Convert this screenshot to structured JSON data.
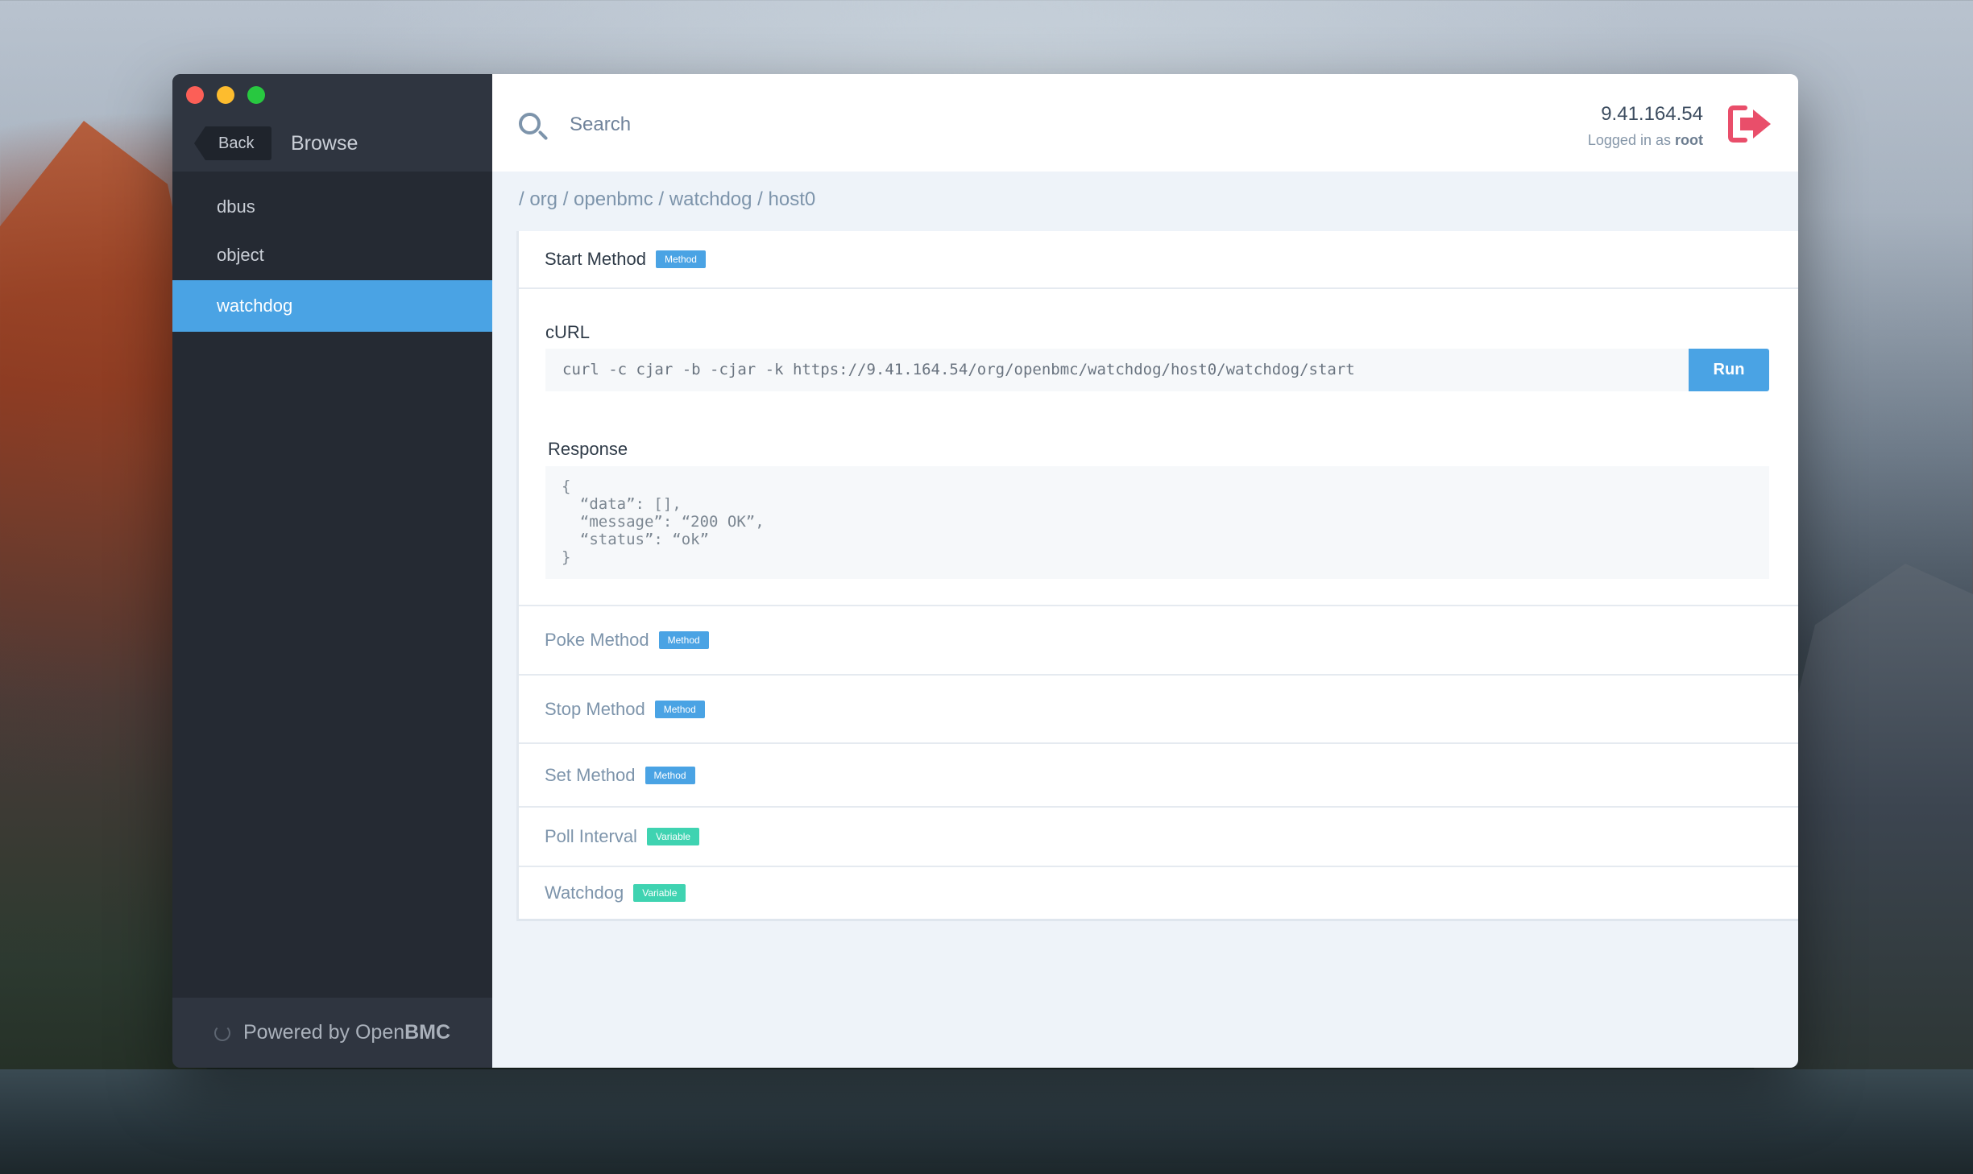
{
  "window": {
    "sidebar": {
      "back_label": "Back",
      "title": "Browse",
      "items": [
        {
          "label": "dbus"
        },
        {
          "label": "object"
        },
        {
          "label": "watchdog",
          "active": true
        }
      ],
      "footer": {
        "prefix": "Powered by Open",
        "brand": "BMC"
      }
    },
    "header": {
      "search_placeholder": "Search",
      "host_ip": "9.41.164.54",
      "logged_in_prefix": "Logged in as",
      "user": "root"
    },
    "breadcrumb": "/ org / openbmc / watchdog / host0",
    "expanded_method": {
      "title": "Start Method",
      "badge": "Method",
      "curl_label": "cURL",
      "curl_command": "curl -c cjar -b -cjar -k https://9.41.164.54/org/openbmc/watchdog/host0/watchdog/start",
      "run_label": "Run",
      "response_label": "Response",
      "response_body": "{\n  “data”: [],\n  “message”: “200 OK”,\n  “status”: “ok”\n}"
    },
    "rows": [
      {
        "title": "Poke Method",
        "badge": "Method",
        "kind": "method"
      },
      {
        "title": "Stop Method",
        "badge": "Method",
        "kind": "method"
      },
      {
        "title": "Set Method",
        "badge": "Method",
        "kind": "method"
      },
      {
        "title": "Poll Interval",
        "badge": "Variable",
        "kind": "variable"
      },
      {
        "title": "Watchdog",
        "badge": "Variable",
        "kind": "variable"
      }
    ]
  },
  "colors": {
    "accent": "#4aa3e4",
    "variable": "#3fd3b1",
    "logout": "#e94e6a",
    "sidebar_bg": "#252a33"
  }
}
